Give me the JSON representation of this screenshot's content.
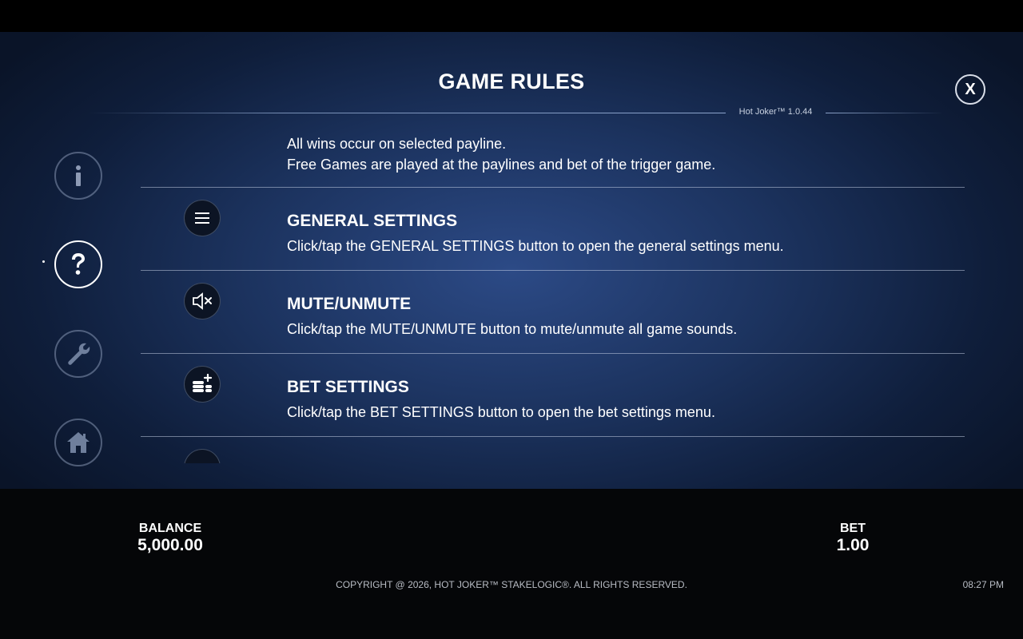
{
  "title": "GAME RULES",
  "version": "Hot Joker™ 1.0.44",
  "close_label": "X",
  "nav": {
    "items": [
      {
        "name": "info",
        "icon": "info-icon"
      },
      {
        "name": "help",
        "icon": "question-icon",
        "active": true
      },
      {
        "name": "settings",
        "icon": "wrench-icon"
      },
      {
        "name": "home",
        "icon": "home-icon"
      }
    ]
  },
  "content": {
    "intro_lines": [
      "All wins occur on selected payline.",
      "Free Games are played at the paylines and bet of the trigger game."
    ],
    "sections": [
      {
        "icon": "menu-icon",
        "title": "GENERAL SETTINGS",
        "text": "Click/tap the GENERAL SETTINGS button to open the general settings menu."
      },
      {
        "icon": "mute-icon",
        "title": "MUTE/UNMUTE",
        "text": "Click/tap the MUTE/UNMUTE button to mute/unmute all game sounds."
      },
      {
        "icon": "coins-plus-icon",
        "title": "BET SETTINGS",
        "text": "Click/tap the BET SETTINGS button to open the bet settings menu."
      }
    ]
  },
  "footer": {
    "balance_label": "BALANCE",
    "balance_value": "5,000.00",
    "bet_label": "BET",
    "bet_value": "1.00",
    "copyright": "COPYRIGHT @ 2026, HOT JOKER™ STAKELOGIC®. ALL RIGHTS RESERVED.",
    "time": "08:27 PM"
  }
}
